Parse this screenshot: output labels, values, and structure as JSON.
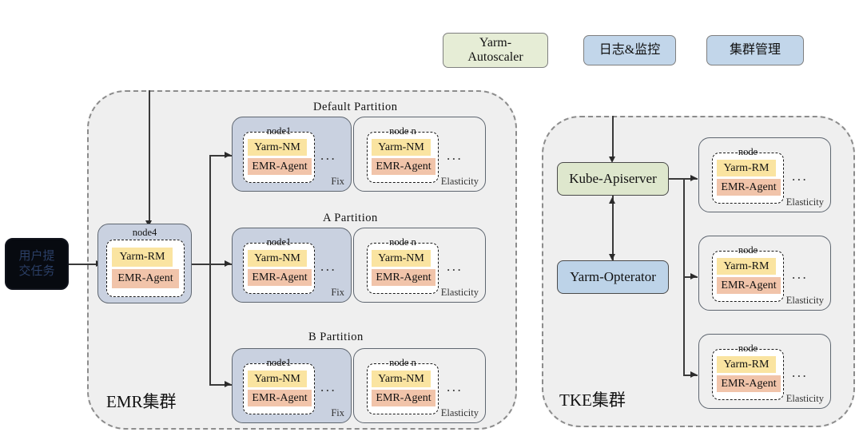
{
  "top_bar": {
    "items": [
      {
        "label": "Yarm-\nAutoscaler",
        "color": "#e6edd6"
      },
      {
        "label": "日志&监控",
        "color": "#c2d6ea"
      },
      {
        "label": "集群管理",
        "color": "#c2d6ea"
      }
    ]
  },
  "user_entry": {
    "label": "用户提\n交任务"
  },
  "emr_cluster": {
    "label": "EMR集群",
    "head_node": {
      "title": "node4",
      "chips": [
        "Yarm-RM",
        "EMR-Agent"
      ]
    },
    "partitions": [
      {
        "title": "Default  Partition",
        "groups": [
          {
            "tag": "Fix",
            "kind": "fix",
            "node_title": "node1",
            "chips": [
              "Yarm-NM",
              "EMR-Agent"
            ],
            "dots": "..."
          },
          {
            "tag": "Elasticity",
            "kind": "elastic",
            "node_title": "node n",
            "chips": [
              "Yarm-NM",
              "EMR-Agent"
            ],
            "dots": "..."
          }
        ]
      },
      {
        "title": "A  Partition",
        "groups": [
          {
            "tag": "Fix",
            "kind": "fix",
            "node_title": "node1",
            "chips": [
              "Yarm-NM",
              "EMR-Agent"
            ],
            "dots": "..."
          },
          {
            "tag": "Elasticity",
            "kind": "elastic",
            "node_title": "node n",
            "chips": [
              "Yarm-NM",
              "EMR-Agent"
            ],
            "dots": "..."
          }
        ]
      },
      {
        "title": "B  Partition",
        "groups": [
          {
            "tag": "Fix",
            "kind": "fix",
            "node_title": "node1",
            "chips": [
              "Yarm-NM",
              "EMR-Agent"
            ],
            "dots": "..."
          },
          {
            "tag": "Elasticity",
            "kind": "elastic",
            "node_title": "node n",
            "chips": [
              "Yarm-NM",
              "EMR-Agent"
            ],
            "dots": "..."
          }
        ]
      }
    ]
  },
  "tke_cluster": {
    "label": "TKE集群",
    "services": [
      {
        "label": "Kube-Apiserver",
        "color": "#dee7cd"
      },
      {
        "label": "Yarm-Opterator",
        "color": "#bdd3e8"
      }
    ],
    "nodes": [
      {
        "node_title": "node",
        "chips": [
          "Yarm-RM",
          "EMR-Agent"
        ],
        "tag": "Elasticity",
        "dots": "..."
      },
      {
        "node_title": "node",
        "chips": [
          "Yarm-RM",
          "EMR-Agent"
        ],
        "tag": "Elasticity",
        "dots": "..."
      },
      {
        "node_title": "node",
        "chips": [
          "Yarm-RM",
          "EMR-Agent"
        ],
        "tag": "Elasticity",
        "dots": "..."
      }
    ]
  },
  "colors": {
    "chip_yellow": "#fae4a1",
    "chip_salmon": "#f1c4aa",
    "group_fix": "#c9d1e0",
    "group_elastic": "#efefef",
    "cluster_bg": "#efefef",
    "line": "#3a3a3a"
  }
}
